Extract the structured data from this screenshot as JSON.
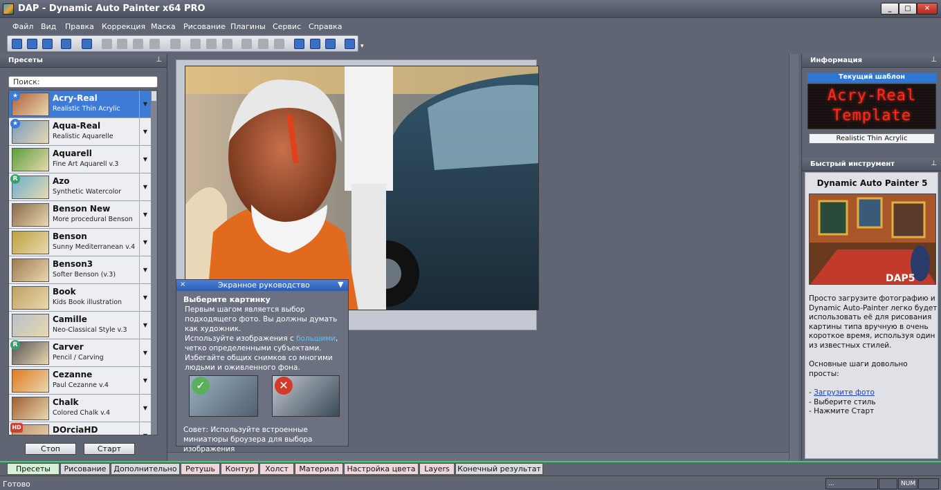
{
  "window": {
    "title": "DAP - Dynamic Auto Painter x64 PRO",
    "min": "_",
    "max": "□",
    "close": "✕"
  },
  "menu": [
    "Файл",
    "Вид",
    "Правка",
    "Коррекция",
    "Маска",
    "Рисование",
    "Плагины",
    "Сервис",
    "Справка"
  ],
  "toolbar_icons": [
    "new-icon",
    "open-icon",
    "save-icon",
    "save-as-icon",
    "star-icon",
    "camera-icon",
    "zoom-in-icon",
    "zoom-out-icon",
    "zoom-1to1-icon",
    "fit-icon",
    "compare-icon",
    "split-icon",
    "crop-icon",
    "stop-icon",
    "play-icon",
    "pause-icon",
    "help-icon",
    "layers-icon",
    "upload-icon",
    "screen-icon"
  ],
  "presets_panel": {
    "title": "Пресеты",
    "search_placeholder": "Поиск:",
    "items": [
      {
        "name": "Acry-Real",
        "desc": "Realistic Thin Acrylic",
        "badge": "★"
      },
      {
        "name": "Aqua-Real",
        "desc": "Realistic Aquarelle",
        "badge": "★"
      },
      {
        "name": "Aquarell",
        "desc": "Fine Art Aquarell v.3",
        "badge": ""
      },
      {
        "name": "Azo",
        "desc": "Synthetic Watercolor",
        "badge": "R"
      },
      {
        "name": "Benson New",
        "desc": "More procedural Benson",
        "badge": ""
      },
      {
        "name": "Benson",
        "desc": "Sunny Mediterranean v.4",
        "badge": ""
      },
      {
        "name": "Benson3",
        "desc": "Softer Benson (v.3)",
        "badge": ""
      },
      {
        "name": "Book",
        "desc": "Kids Book illustration",
        "badge": ""
      },
      {
        "name": "Camille",
        "desc": "Neo-Classical Style v.3",
        "badge": ""
      },
      {
        "name": "Carver",
        "desc": "Pencil / Carving",
        "badge": "R"
      },
      {
        "name": "Cezanne",
        "desc": "Paul Cezanne v.4",
        "badge": ""
      },
      {
        "name": "Chalk",
        "desc": "Colored Chalk v.4",
        "badge": ""
      },
      {
        "name": "DOrciaHD",
        "desc": "",
        "badge": "HD"
      }
    ],
    "stop_label": "Стоп",
    "start_label": "Старт"
  },
  "guide": {
    "title": "Экранное руководство",
    "heading": "Выберите картинку",
    "p1": "Первым шагом является выбор подходящего фото. Вы должны думать как художник.",
    "p2a": "Используйте изображения с ",
    "p2link": "большими",
    "p2b": ", четко определенными субъектами.",
    "p3": "Избегайте общих снимков со многими людьми и оживленного фона.",
    "tip": "Совет: Используйте встроенные миниатюры броузера для выбора изображения"
  },
  "info_panel": {
    "title": "Информация",
    "current_template_label": "Текущий шаблон",
    "led_line1": "Acry-Real",
    "led_line2": "Template",
    "template_desc": "Realistic Thin Acrylic"
  },
  "quick_panel": {
    "title": "Быстрый инструмент",
    "heading": "Dynamic Auto Painter 5",
    "logo": "DAP5",
    "intro": "Просто загрузите фотографию и Dynamic Auto-Painter легко будет использовать её для рисования картины типа вручную в очень короткое время, используя один из известных стилей.",
    "steps_intro": "Основные шаги довольно просты:",
    "step1_prefix": "- ",
    "step1_link": "Загрузите фото",
    "step2": "- Выберите стиль",
    "step3": "- Нажмите Старт"
  },
  "tabs": [
    "Пресеты",
    "Рисование",
    "Дополнительно",
    "Ретушь",
    "Контур",
    "Холст",
    "Материал",
    "Настройка цвета",
    "Layers",
    "Конечный результат"
  ],
  "status": {
    "text": "Готово",
    "dots": "...",
    "num": "NUM"
  },
  "colors": {
    "accent": "#3d7bd6",
    "active_tab": "#3ed070",
    "led": "#ff2a1a"
  }
}
